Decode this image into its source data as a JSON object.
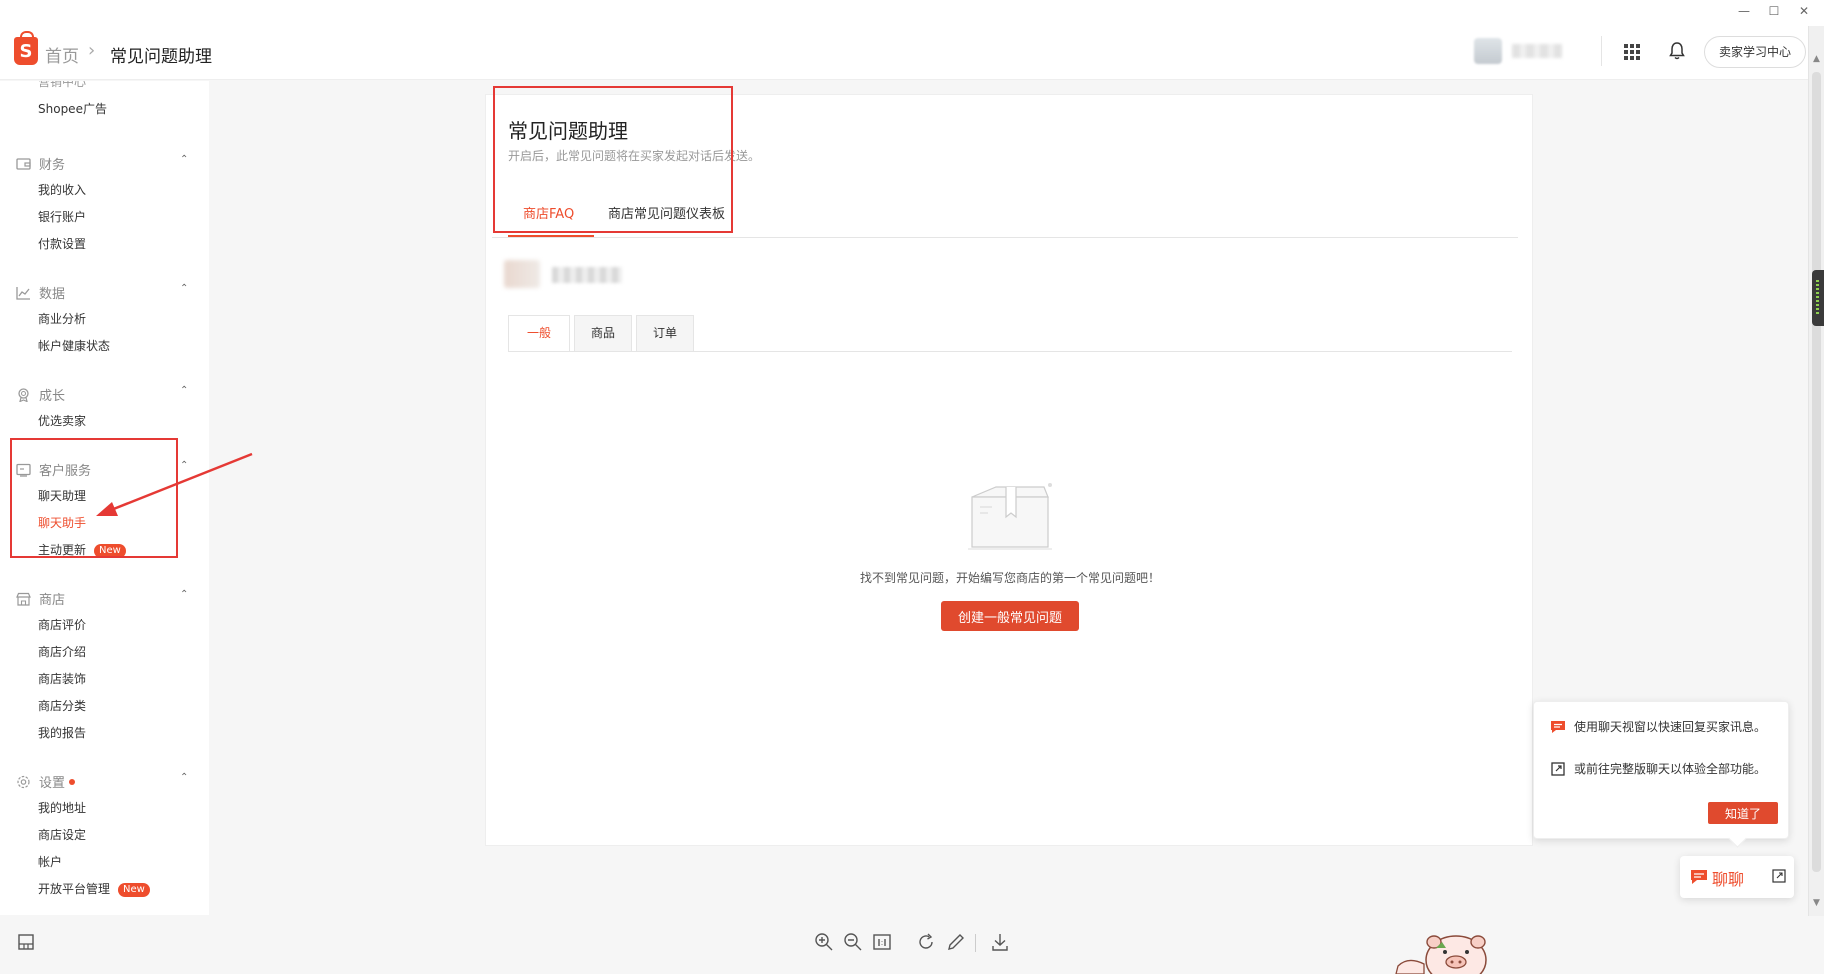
{
  "window": {
    "minimize": "—",
    "maximize": "☐",
    "close": "✕"
  },
  "header": {
    "logo_letter": "S",
    "breadcrumb_home": "首页",
    "breadcrumb_sep": "›",
    "breadcrumb_current": "常见问题助理",
    "learning_center": "卖家学习中心"
  },
  "sidebar": {
    "cut_item": "营销中心",
    "shopee_ads": "Shopee广告",
    "groups": [
      {
        "title": "财务",
        "icon": "wallet-icon",
        "items": [
          "我的收入",
          "银行账户",
          "付款设置"
        ]
      },
      {
        "title": "数据",
        "icon": "chart-icon",
        "items": [
          "商业分析",
          "帐户健康状态"
        ]
      },
      {
        "title": "成长",
        "icon": "badge-icon",
        "items": [
          "优选卖家"
        ]
      },
      {
        "title": "客户服务",
        "icon": "chat-box-icon",
        "items": [
          "聊天助理",
          "聊天助手",
          "主动更新"
        ]
      },
      {
        "title": "商店",
        "icon": "store-icon",
        "items": [
          "商店评价",
          "商店介绍",
          "商店装饰",
          "商店分类",
          "我的报告"
        ]
      },
      {
        "title": "设置",
        "icon": "gear-icon",
        "items": [
          "我的地址",
          "商店设定",
          "帐户",
          "开放平台管理"
        ]
      }
    ],
    "new_badge": "New",
    "chevron": "⌃"
  },
  "main": {
    "title": "常见问题助理",
    "subtitle": "开启后，此常见问题将在买家发起对话后发送。",
    "tabs": [
      "商店FAQ",
      "商店常见问题仪表板"
    ],
    "sub_tabs": [
      "一般",
      "商品",
      "订单"
    ],
    "empty_text": "找不到常见问题，开始编写您商店的第一个常见问题吧！",
    "create_button": "创建一般常见问题"
  },
  "chat_popup": {
    "line1": "使用聊天视窗以快速回复买家讯息。",
    "line2": "或前往完整版聊天以体验全部功能。",
    "ok": "知道了",
    "chat_label": "聊聊"
  },
  "colors": {
    "accent": "#ee4d2d",
    "annotation": "#e53935"
  }
}
